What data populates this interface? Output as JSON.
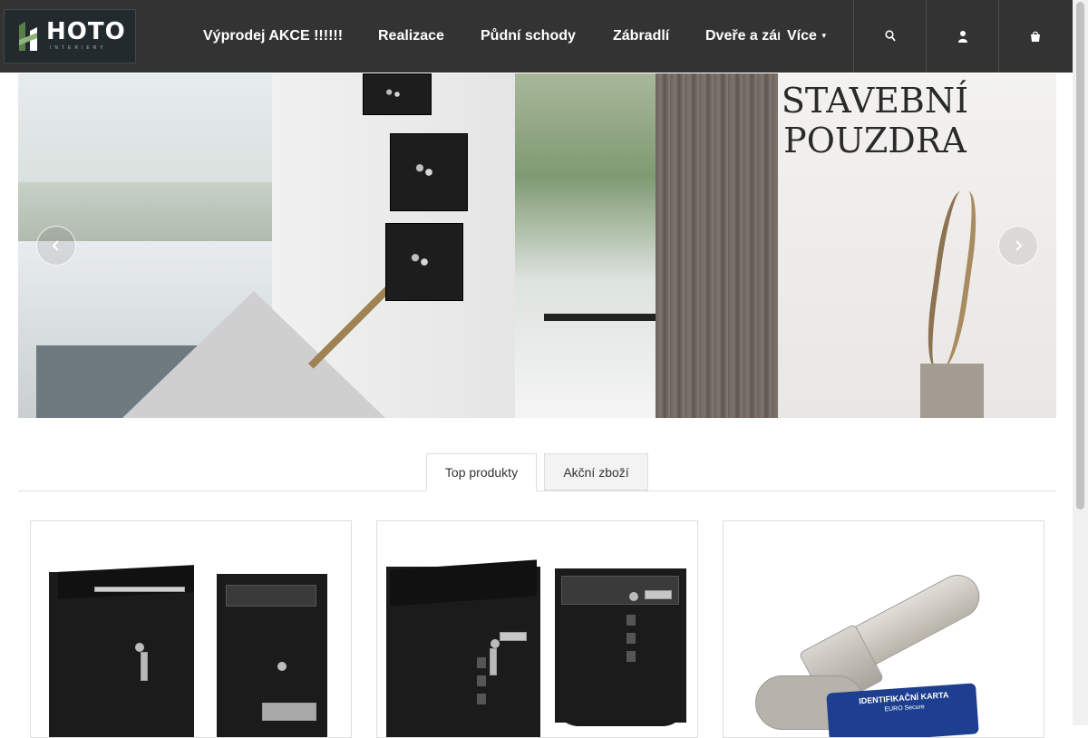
{
  "logo": {
    "text": "HOTO",
    "subtitle": "INTERIERY"
  },
  "nav": {
    "items": [
      "Výprodej AKCE !!!!!!",
      "Realizace",
      "Půdní schody",
      "Zábradlí",
      "Dveře a zárubně"
    ],
    "more_label": "Více",
    "more_caret_icon": "chevron-down-icon"
  },
  "header_buttons": [
    {
      "name": "search-icon"
    },
    {
      "name": "user-icon"
    },
    {
      "name": "cart-icon"
    }
  ],
  "banner": {
    "title_line1": "STAVEBNÍ",
    "title_line2": "POUZDRA",
    "prev_icon": "chevron-left-icon",
    "next_icon": "chevron-right-icon"
  },
  "tabs": [
    {
      "label": "Top produkty",
      "active": true
    },
    {
      "label": "Akční zboží",
      "active": false
    }
  ],
  "products": [
    {
      "image": "two-black-mailboxes"
    },
    {
      "image": "two-black-mailboxes-with-windows"
    },
    {
      "image": "door-lock-cylinder-with-keys",
      "card_text_line1": "IDENTIFIKAČNÍ KARTA",
      "card_text_line2": "EURO Secure"
    }
  ],
  "colors": {
    "header_bg": "#333333",
    "nav_text": "#ffffff",
    "accent_gold": "#9f8253"
  }
}
